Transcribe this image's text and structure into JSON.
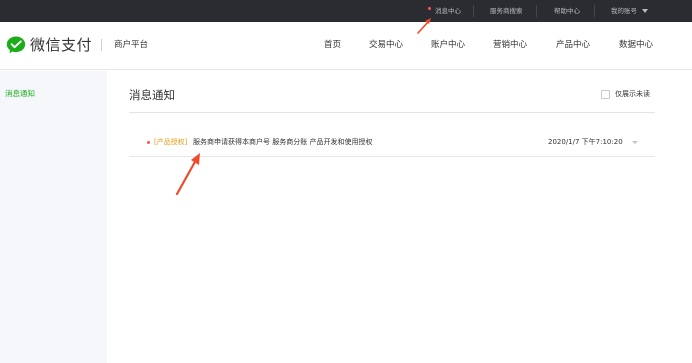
{
  "topbar": {
    "items": [
      "消息中心",
      "服务商搜索",
      "帮助中心",
      "我的账号"
    ]
  },
  "header": {
    "brand": "微信支付",
    "platform": "商户平台",
    "nav": [
      "首页",
      "交易中心",
      "账户中心",
      "营销中心",
      "产品中心",
      "数据中心"
    ]
  },
  "sidebar": {
    "items": [
      "消息通知"
    ]
  },
  "main": {
    "title": "消息通知",
    "unread_filter_label": "仅展示未读",
    "messages": [
      {
        "tag": "[产品授权]",
        "text": "服务商申请获得本商户号 服务商分账 产品开发和使用授权",
        "time": "2020/1/7 下午7:10:20"
      }
    ]
  },
  "colors": {
    "topbar_bg": "#2b2c31",
    "brand_green": "#1aad19",
    "tag_orange": "#e89c15",
    "unread_dot": "#f25b4b",
    "annotation_arrow": "#f04a2c"
  },
  "icons": [
    "wechat-pay-logo-icon",
    "dropdown-caret-icon",
    "chevron-down-icon",
    "checkbox-icon"
  ]
}
